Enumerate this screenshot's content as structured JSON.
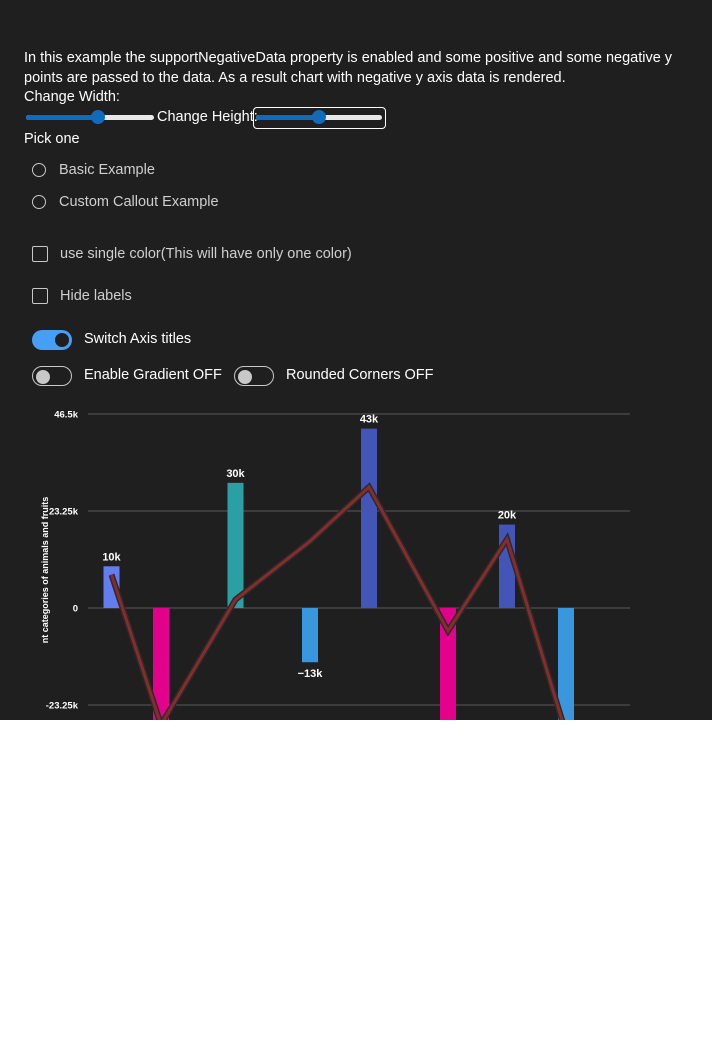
{
  "description": "In this example the supportNegativeData property is enabled and some positive and some negative y points are passed to the data. As a result chart with negative y axis data is rendered.",
  "controls": {
    "change_width_label": "Change Width:",
    "change_height_label": "Change Height:",
    "width_slider_value": 0.56,
    "height_slider_value": 0.5,
    "pick_one_label": "Pick one",
    "radio_options": [
      "Basic Example",
      "Custom Callout Example"
    ],
    "single_color_label": "use single color(This will have only one color)",
    "hide_labels_label": "Hide labels",
    "switch_axis_titles_label": "Switch Axis titles",
    "switch_axis_titles_on": true,
    "enable_gradient_label": "Enable Gradient OFF",
    "rounded_corners_label": "Rounded Corners OFF"
  },
  "colors": {
    "accent": "#0f6cbd",
    "toggle_on": "#479ef5",
    "line": "#8a2b2b"
  },
  "chart_data": {
    "type": "bar",
    "ylabel": "nt categories of animals and fruits",
    "y_ticks": [
      "46.5k",
      "23.25k",
      "0",
      "-23.25k"
    ],
    "y_tick_values": [
      46500,
      23250,
      0,
      -23250
    ],
    "bars": [
      {
        "value": 10000,
        "label": "10k",
        "color": "#637cef"
      },
      {
        "value": -28000,
        "label": "",
        "color": "#e3008c"
      },
      {
        "value": 30000,
        "label": "30k",
        "color": "#2aa0a4"
      },
      {
        "value": -13000,
        "label": "−13k",
        "color": "#3a96dd"
      },
      {
        "value": 43000,
        "label": "43k",
        "color": "#4356b8"
      },
      {
        "value": -28000,
        "label": "",
        "color": "#e3008c"
      },
      {
        "value": 20000,
        "label": "20k",
        "color": "#4356b8"
      },
      {
        "value": -28000,
        "label": "",
        "color": "#3a96dd"
      }
    ],
    "line": [
      8000,
      -28000,
      2000,
      16000,
      29000,
      -5500,
      16500,
      -30000
    ]
  }
}
